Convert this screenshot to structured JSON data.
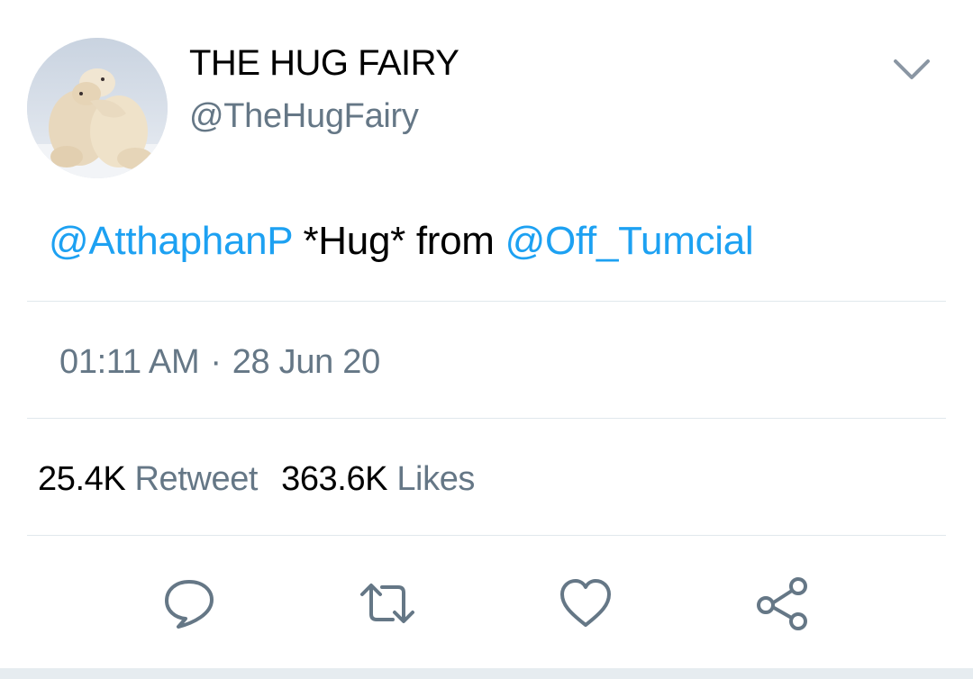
{
  "author": {
    "display_name": "THE HUG FAIRY",
    "handle": "@TheHugFairy",
    "avatar_icon": "polar-bears-hugging-avatar"
  },
  "menu": {
    "icon": "chevron-down-icon"
  },
  "tweet": {
    "segments": [
      {
        "type": "mention",
        "text": "@AtthaphanP"
      },
      {
        "type": "text",
        "text": " *Hug* from "
      },
      {
        "type": "mention",
        "text": "@Off_Tumcial"
      }
    ]
  },
  "meta": {
    "time": "01:11 AM",
    "separator": "·",
    "date": "28 Jun 20"
  },
  "stats": {
    "retweet_count": "25.4K",
    "retweet_label": "Retweet",
    "like_count": "363.6K",
    "like_label": "Likes"
  },
  "actions": [
    {
      "name": "reply",
      "icon": "comment-bubble-icon"
    },
    {
      "name": "retweet",
      "icon": "retweet-arrows-icon"
    },
    {
      "name": "like",
      "icon": "heart-icon"
    },
    {
      "name": "share",
      "icon": "share-nodes-icon"
    }
  ],
  "colors": {
    "mention": "#1da1f2",
    "secondary_text": "#657786",
    "icon": "#657786",
    "divider": "#e1e8ed"
  }
}
